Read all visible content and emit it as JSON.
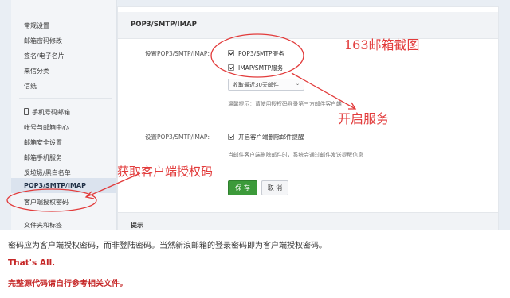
{
  "sidebar": {
    "items": [
      {
        "label": "常规设置"
      },
      {
        "label": "邮箱密码修改"
      },
      {
        "label": "签名/电子名片"
      },
      {
        "label": "来信分类"
      },
      {
        "label": "信纸"
      },
      {
        "label": "手机号码邮箱"
      },
      {
        "label": "帐号与邮箱中心"
      },
      {
        "label": "邮箱安全设置"
      },
      {
        "label": "邮箱手机服务"
      },
      {
        "label": "反垃圾/黑白名单"
      },
      {
        "label": "POP3/SMTP/IMAP"
      },
      {
        "label": "客户端授权密码"
      },
      {
        "label": "文件夹和标签"
      }
    ]
  },
  "panel": {
    "title": "POP3/SMTP/IMAP",
    "row1_label": "设置POP3/SMTP/IMAP:",
    "pop3_option": "POP3/SMTP服务",
    "imap_option": "IMAP/SMTP服务",
    "select_value": "收取最近30天邮件",
    "select_arrow": "⌄",
    "tip": "温馨提示：请使用授权码登录第三方邮件客户端",
    "row2_label": "设置POP3/SMTP/IMAP:",
    "delete_option": "开启客户端删除邮件提醒",
    "delete_hint": "当邮件客户端删除邮件时，系统会通过邮件发送提醒信息",
    "save_label": "保 存",
    "cancel_label": "取 消",
    "section2_title": "提示"
  },
  "annotations": {
    "screenshot_note": "163邮箱截图",
    "open_service": "开启服务",
    "get_code": "获取客户端授权码"
  },
  "caption": {
    "line1": "密码应为客户端授权密码，而非登陆密码。当然新浪邮箱的登录密码即为客户端授权密码。",
    "line2": "That's All.",
    "line3": "完整源代码请自行参考相关文件。"
  },
  "colors": {
    "annotation_red": "#e23b3b",
    "caption_red": "#c62828",
    "save_green": "#3c9a3a"
  }
}
